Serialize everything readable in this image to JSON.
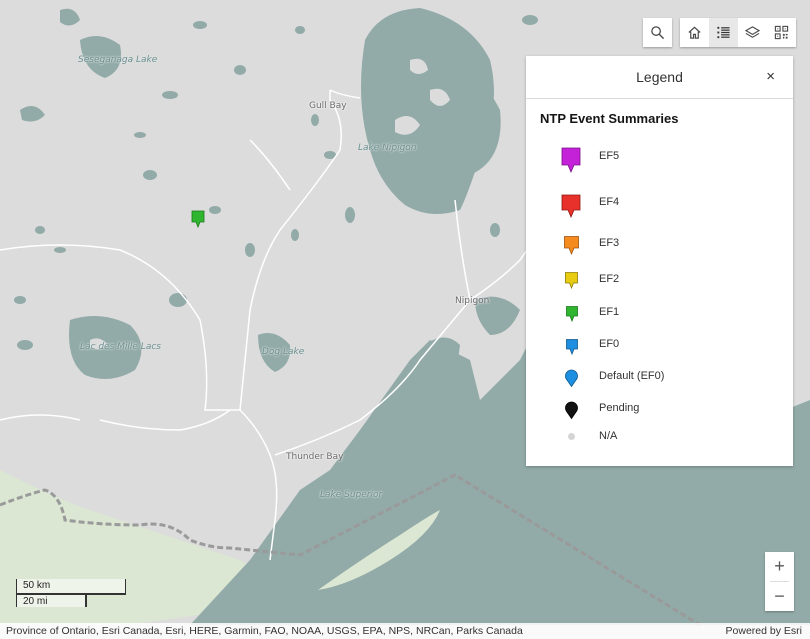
{
  "map": {
    "place_labels": [
      {
        "id": "seseganaga",
        "text": "Seseganaga Lake",
        "type": "water"
      },
      {
        "id": "gull-bay",
        "text": "Gull Bay",
        "type": "town"
      },
      {
        "id": "lake-nipigon",
        "text": "Lake Nipigon",
        "type": "water"
      },
      {
        "id": "nipigon",
        "text": "Nipigon",
        "type": "town"
      },
      {
        "id": "lac-des-mille-lacs",
        "text": "Lac des Mille Lacs",
        "type": "water"
      },
      {
        "id": "dog-lake",
        "text": "Dog Lake",
        "type": "water"
      },
      {
        "id": "thunder-bay",
        "text": "Thunder Bay",
        "type": "town"
      },
      {
        "id": "lake-superior",
        "text": "Lake Superior",
        "type": "water"
      }
    ],
    "markers": [
      {
        "category": "EF1",
        "color": "#2fb52f"
      }
    ],
    "colors": {
      "land": "#dcdcdc",
      "water": "#92aba8",
      "forest": "#dbe6d3",
      "roads": "#ffffff",
      "boundary": "#8c8c8c"
    }
  },
  "toolbar": {
    "search_icon": "search-icon",
    "buttons": [
      {
        "name": "home-button",
        "icon": "home-icon"
      },
      {
        "name": "legend-button",
        "icon": "legend-list-icon",
        "active": true
      },
      {
        "name": "layers-button",
        "icon": "layers-icon"
      },
      {
        "name": "qr-code-button",
        "icon": "qr-code-icon"
      }
    ]
  },
  "legend": {
    "title": "Legend",
    "close_label": "×",
    "layer_title": "NTP Event Summaries",
    "items": [
      {
        "label": "EF5",
        "color": "#c322d9",
        "shape": "square-pin"
      },
      {
        "label": "EF4",
        "color": "#e8312b",
        "shape": "square-pin"
      },
      {
        "label": "EF3",
        "color": "#f58a1f",
        "shape": "square-pin"
      },
      {
        "label": "EF2",
        "color": "#e8cc12",
        "shape": "square-pin"
      },
      {
        "label": "EF1",
        "color": "#2fb52f",
        "shape": "square-pin"
      },
      {
        "label": "EF0",
        "color": "#1e8fe0",
        "shape": "square-pin"
      },
      {
        "label": "Default (EF0)",
        "color": "#1e8fe0",
        "shape": "round-pin"
      },
      {
        "label": "Pending",
        "color": "#111111",
        "shape": "round-pin"
      },
      {
        "label": "N/A",
        "color": "#d4d4d4",
        "shape": "dot"
      }
    ]
  },
  "zoom": {
    "in_label": "+",
    "out_label": "−"
  },
  "scalebar": {
    "metric": "50 km",
    "imperial": "20 mi"
  },
  "attribution": {
    "sources": "Province of Ontario, Esri Canada, Esri, HERE, Garmin, FAO, NOAA, USGS, EPA, NPS, NRCan, Parks Canada",
    "powered_by": "Powered by Esri"
  }
}
